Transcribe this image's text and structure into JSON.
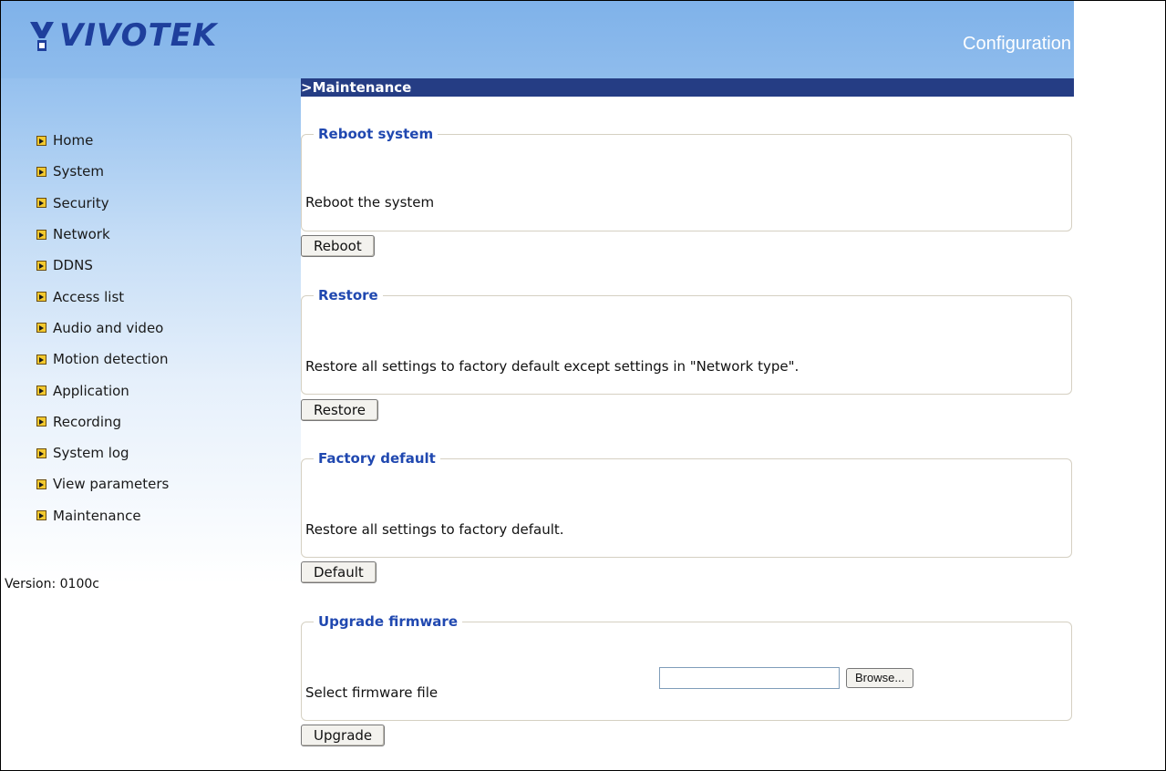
{
  "header": {
    "brand": "VIVOTEK",
    "title": "Configuration"
  },
  "section": {
    "title": ">Maintenance"
  },
  "sidebar": {
    "items": [
      {
        "label": "Home"
      },
      {
        "label": "System"
      },
      {
        "label": "Security"
      },
      {
        "label": "Network"
      },
      {
        "label": "DDNS"
      },
      {
        "label": "Access list"
      },
      {
        "label": "Audio and video"
      },
      {
        "label": "Motion detection"
      },
      {
        "label": "Application"
      },
      {
        "label": "Recording"
      },
      {
        "label": "System log"
      },
      {
        "label": "View parameters"
      },
      {
        "label": "Maintenance"
      }
    ],
    "version": "Version: 0100c"
  },
  "reboot": {
    "legend": "Reboot system",
    "text": "Reboot the system",
    "button": "Reboot"
  },
  "restore": {
    "legend": "Restore",
    "text": "Restore all settings to factory default except settings in \"Network type\".",
    "button": "Restore"
  },
  "factory": {
    "legend": "Factory default",
    "text": "Restore all settings to factory default.",
    "button": "Default"
  },
  "upgrade": {
    "legend": "Upgrade firmware",
    "label": "Select firmware file",
    "file_value": "",
    "browse_button": "Browse...",
    "button": "Upgrade"
  },
  "colors": {
    "header_blue": "#7fb2ea",
    "section_bar": "#253d84",
    "legend_text": "#2048b0"
  }
}
